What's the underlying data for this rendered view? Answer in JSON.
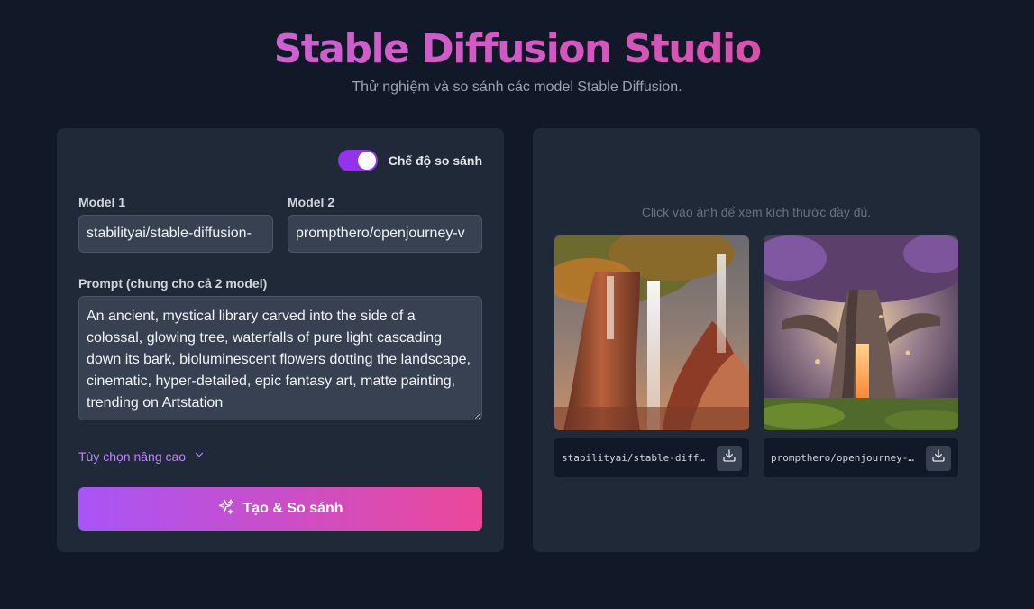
{
  "header": {
    "title": "Stable Diffusion Studio",
    "subtitle": "Thử nghiệm và so sánh các model Stable Diffusion."
  },
  "form": {
    "compare_toggle": {
      "label": "Chế độ so sánh",
      "on": true
    },
    "model1": {
      "label": "Model 1",
      "value": "stabilityai/stable-diffusion-"
    },
    "model2": {
      "label": "Model 2",
      "value": "prompthero/openjourney-v"
    },
    "prompt": {
      "label": "Prompt (chung cho cả 2 model)",
      "value": "An ancient, mystical library carved into the side of a colossal, glowing tree, waterfalls of pure light cascading down its bark, bioluminescent flowers dotting the landscape, cinematic, hyper-detailed, epic fantasy art, matte painting, trending on Artstation"
    },
    "advanced_label": "Tùy chọn nâng cao",
    "generate_label": "Tạo & So sánh"
  },
  "results": {
    "hint": "Click vào ảnh để xem kích thước đầy đủ.",
    "items": [
      {
        "caption": "stabilityai/stable-diff…",
        "icon": "download-icon"
      },
      {
        "caption": "prompthero/openjourney-…",
        "icon": "download-icon"
      }
    ]
  },
  "colors": {
    "background": "#111827",
    "panel": "#1f2937",
    "accent_purple": "#9333ea",
    "accent_pink": "#ec4899"
  }
}
